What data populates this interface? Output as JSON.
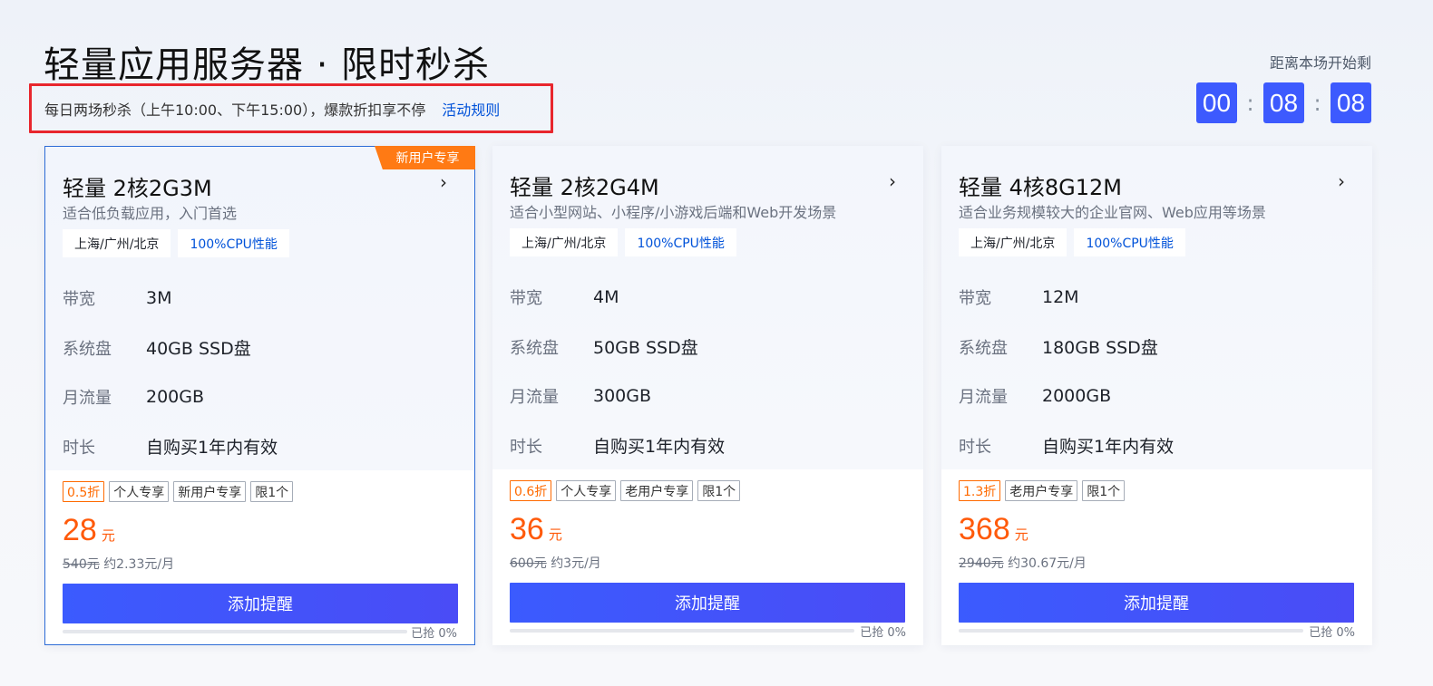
{
  "header": {
    "title": "轻量应用服务器 · 限时秒杀",
    "subtitle": "每日两场秒杀（上午10:00、下午15:00），爆款折扣享不停",
    "rules_link": "活动规则"
  },
  "countdown": {
    "label": "距离本场开始剩",
    "hours": "00",
    "minutes": "08",
    "seconds": "08",
    "separator": ":"
  },
  "colors": {
    "accent": "#3d5afe",
    "price": "#ff5a0a",
    "ribbon": "#ff7a14",
    "highlight_border": "#e8262d"
  },
  "cards": [
    {
      "ribbon": "新用户专享",
      "name": "轻量 2核2G3M",
      "desc": "适合低负载应用，入门首选",
      "tags": [
        "上海/广州/北京",
        "100%CPU性能"
      ],
      "specs": [
        {
          "label": "带宽",
          "value": "3M"
        },
        {
          "label": "系统盘",
          "value": "40GB SSD盘"
        },
        {
          "label": "月流量",
          "value": "200GB"
        },
        {
          "label": "时长",
          "value": "自购买1年内有效"
        }
      ],
      "badges": [
        "0.5折",
        "个人专享",
        "新用户专享",
        "限1个"
      ],
      "price": "28",
      "price_unit": "元",
      "original_price": "540元",
      "monthly": "约2.33元/月",
      "button": "添加提醒",
      "progress_text": "已抢 0%",
      "progress": 0
    },
    {
      "ribbon": "",
      "name": "轻量 2核2G4M",
      "desc": "适合小型网站、小程序/小游戏后端和Web开发场景",
      "tags": [
        "上海/广州/北京",
        "100%CPU性能"
      ],
      "specs": [
        {
          "label": "带宽",
          "value": "4M"
        },
        {
          "label": "系统盘",
          "value": "50GB SSD盘"
        },
        {
          "label": "月流量",
          "value": "300GB"
        },
        {
          "label": "时长",
          "value": "自购买1年内有效"
        }
      ],
      "badges": [
        "0.6折",
        "个人专享",
        "老用户专享",
        "限1个"
      ],
      "price": "36",
      "price_unit": "元",
      "original_price": "600元",
      "monthly": "约3元/月",
      "button": "添加提醒",
      "progress_text": "已抢 0%",
      "progress": 0
    },
    {
      "ribbon": "",
      "name": "轻量 4核8G12M",
      "desc": "适合业务规模较大的企业官网、Web应用等场景",
      "tags": [
        "上海/广州/北京",
        "100%CPU性能"
      ],
      "specs": [
        {
          "label": "带宽",
          "value": "12M"
        },
        {
          "label": "系统盘",
          "value": "180GB SSD盘"
        },
        {
          "label": "月流量",
          "value": "2000GB"
        },
        {
          "label": "时长",
          "value": "自购买1年内有效"
        }
      ],
      "badges": [
        "1.3折",
        "老用户专享",
        "限1个"
      ],
      "price": "368",
      "price_unit": "元",
      "original_price": "2940元",
      "monthly": "约30.67元/月",
      "button": "添加提醒",
      "progress_text": "已抢 0%",
      "progress": 0
    }
  ]
}
